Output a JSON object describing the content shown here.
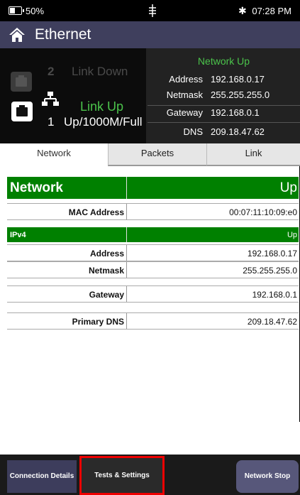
{
  "status_bar": {
    "battery_percent": "50%",
    "battery_level": 0.5,
    "clock": "07:28 PM"
  },
  "header": {
    "title": "Ethernet"
  },
  "ports": {
    "port2": {
      "number": "2",
      "state": "Link Down"
    },
    "port1": {
      "number": "1",
      "state": "Link Up",
      "speed": "Up/1000M/Full"
    }
  },
  "network_info": {
    "status": "Network Up",
    "rows": [
      {
        "label": "Address",
        "value": "192.168.0.17"
      },
      {
        "label": "Netmask",
        "value": "255.255.255.0"
      },
      {
        "label": "Gateway",
        "value": "192.168.0.1"
      },
      {
        "label": "DNS",
        "value": "209.18.47.62"
      }
    ]
  },
  "tabs": [
    {
      "label": "Network",
      "active": true
    },
    {
      "label": "Packets",
      "active": false
    },
    {
      "label": "Link",
      "active": false
    }
  ],
  "network_section": {
    "title": "Network",
    "state": "Up",
    "mac_label": "MAC Address",
    "mac_value": "00:07:11:10:09:e0"
  },
  "ipv4_section": {
    "title": "IPv4",
    "state": "Up",
    "rows": [
      {
        "label": "Address",
        "value": "192.168.0.17"
      },
      {
        "label": "Netmask",
        "value": "255.255.255.0"
      },
      {
        "label": "Gateway",
        "value": "192.168.0.1"
      },
      {
        "label": "Primary DNS",
        "value": "209.18.47.62"
      }
    ]
  },
  "bottom_bar": {
    "connection_details": "Connection Details",
    "tests_settings": "Tests & Settings",
    "network_stop": "Network Stop"
  },
  "colors": {
    "title_bar": "#3f3f5d",
    "section_green": "#008000",
    "link_up_green": "#4bc34b",
    "highlight_red": "#ee0000"
  },
  "icons": [
    "battery-icon",
    "ethernet-network-icon",
    "bluetooth-icon",
    "home-icon",
    "ethernet-port-icon",
    "network-topology-icon"
  ]
}
